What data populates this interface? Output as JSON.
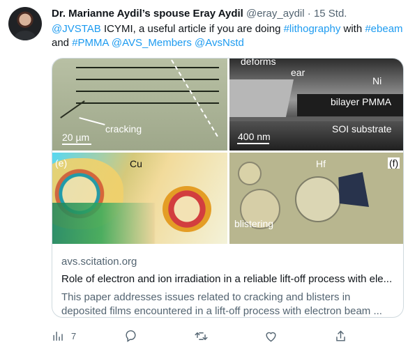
{
  "tweet": {
    "author_name": "Dr. Marianne Aydil’s spouse Eray Aydil",
    "author_handle": "@eray_aydil",
    "separator": "·",
    "time": "15 Std.",
    "text_segments": [
      {
        "text": "@JVSTAB",
        "type": "mention"
      },
      {
        "text": " ICYMI, a useful article if you are doing ",
        "type": "plain"
      },
      {
        "text": "#lithography",
        "type": "hashtag"
      },
      {
        "text": " with ",
        "type": "plain"
      },
      {
        "text": "#ebeam",
        "type": "hashtag"
      },
      {
        "text": " and ",
        "type": "plain"
      },
      {
        "text": "#PMMA",
        "type": "hashtag"
      },
      {
        "text": " ",
        "type": "plain"
      },
      {
        "text": "@AVS_Members",
        "type": "mention"
      },
      {
        "text": " ",
        "type": "plain"
      },
      {
        "text": "@AvsNstd",
        "type": "mention"
      }
    ]
  },
  "card": {
    "image": {
      "top_left": {
        "scale": "20 µm",
        "label": "cracking"
      },
      "top_right": {
        "top_text": "deforms",
        "ear": "ear",
        "ni": "Ni",
        "bilayer": "bilayer PMMA",
        "substrate": "SOI substrate",
        "scale": "400 nm"
      },
      "bottom_left": {
        "panel": "(e)",
        "metal": "Cu"
      },
      "bottom_right": {
        "metal": "Hf",
        "panel": "(f)",
        "label": "blistering"
      }
    },
    "domain": "avs.scitation.org",
    "title": "Role of electron and ion irradiation in a reliable lift-off process with ele...",
    "description": "This paper addresses issues related to cracking and blisters in deposited films encountered in a lift-off process with electron beam ..."
  },
  "actions": {
    "analytics_count": "7",
    "icons": [
      "analytics-icon",
      "reply-icon",
      "retweet-icon",
      "like-icon",
      "share-icon"
    ]
  },
  "colors": {
    "link": "#1d9bf0",
    "text": "#0f1419",
    "muted": "#536471",
    "border": "#cfd9de"
  }
}
